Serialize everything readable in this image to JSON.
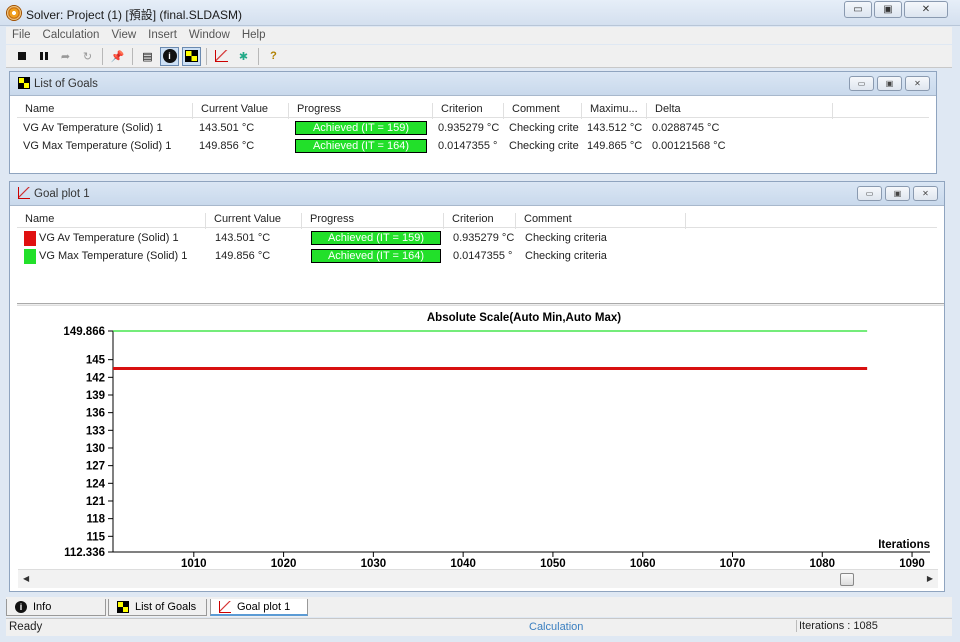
{
  "window": {
    "title": "Solver: Project (1) [預設] (final.SLDASM)",
    "btn_minimize": "▭",
    "btn_maximize": "▣",
    "btn_close": "✕"
  },
  "menu": [
    "File",
    "Calculation",
    "View",
    "Insert",
    "Window",
    "Help"
  ],
  "goals_panel": {
    "title": "List of Goals",
    "columns": [
      "Name",
      "Current Value",
      "Progress",
      "Criterion",
      "Comment",
      "Maximu...",
      "Delta"
    ],
    "rows": [
      {
        "name": "VG Av Temperature (Solid) 1",
        "current": "143.501 °C",
        "progress": "Achieved (IT = 159)",
        "criterion": "0.935279 °C",
        "comment": "Checking crite",
        "maximum": "143.512 °C",
        "delta": "0.0288745 °C"
      },
      {
        "name": "VG Max Temperature (Solid) 1",
        "current": "149.856 °C",
        "progress": "Achieved (IT = 164)",
        "criterion": "0.0147355 °",
        "comment": "Checking crite",
        "maximum": "149.865 °C",
        "delta": "0.00121568 °C"
      }
    ]
  },
  "plot_panel": {
    "title": "Goal plot 1",
    "columns": [
      "Name",
      "Current Value",
      "Progress",
      "Criterion",
      "Comment"
    ],
    "rows": [
      {
        "name": "VG Av Temperature (Solid) 1",
        "current": "143.501 °C",
        "progress": "Achieved (IT = 159)",
        "criterion": "0.935279 °C",
        "comment": "Checking criteria",
        "color": "#e01010"
      },
      {
        "name": "VG Max Temperature (Solid) 1",
        "current": "149.856 °C",
        "progress": "Achieved (IT = 164)",
        "criterion": "0.0147355 °",
        "comment": "Checking criteria",
        "color": "#22e02a"
      }
    ]
  },
  "chart_data": {
    "type": "line",
    "title": "Absolute Scale(Auto Min,Auto Max)",
    "xlabel": "Iterations",
    "ylabel": "",
    "xlim": [
      1001,
      1092
    ],
    "ylim": [
      112.336,
      149.866
    ],
    "x_ticks": [
      1010,
      1020,
      1030,
      1040,
      1050,
      1060,
      1070,
      1080,
      1090
    ],
    "y_ticks": [
      112.336,
      115,
      118,
      121,
      124,
      127,
      130,
      133,
      136,
      139,
      142,
      145,
      149.866
    ],
    "y_tick_labels": [
      "112.336",
      "115",
      "118",
      "121",
      "124",
      "127",
      "130",
      "133",
      "136",
      "139",
      "142",
      "145",
      "149.866"
    ],
    "series": [
      {
        "name": "VG Av Temperature (Solid) 1",
        "color": "#d81010",
        "x": [
          1001,
          1085
        ],
        "values": [
          143.5,
          143.5
        ]
      },
      {
        "name": "VG Max Temperature (Solid) 1",
        "color": "#22e02a",
        "x": [
          1001,
          1085
        ],
        "values": [
          149.86,
          149.86
        ]
      }
    ]
  },
  "tabs": [
    "Info",
    "List of Goals",
    "Goal plot 1"
  ],
  "status": {
    "ready": "Ready",
    "calc": "Calculation",
    "iterations": "Iterations : 1085"
  }
}
